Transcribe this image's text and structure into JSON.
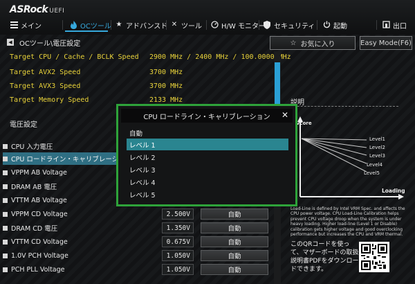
{
  "brand": {
    "name": "ASRock",
    "suffix": "UEFI"
  },
  "nav": [
    {
      "id": "main",
      "label": "メイン",
      "icon": "list-icon"
    },
    {
      "id": "oc",
      "label": "OCツール",
      "icon": "flame-icon",
      "active": true
    },
    {
      "id": "advanced",
      "label": "アドバンスド",
      "icon": "star-icon"
    },
    {
      "id": "tool",
      "label": "ツール",
      "icon": "wrench-icon"
    },
    {
      "id": "hw",
      "label": "H/W モニター",
      "icon": "monitor-icon"
    },
    {
      "id": "security",
      "label": "セキュリティ",
      "icon": "shield-icon"
    },
    {
      "id": "boot",
      "label": "起動",
      "icon": "power-icon"
    },
    {
      "id": "exit",
      "label": "出口",
      "icon": "exit-icon"
    }
  ],
  "breadcrumb": "OCツール\\電圧設定",
  "buttons": {
    "favorite": "お気に入り",
    "easy_mode": "Easy Mode(F6)"
  },
  "info_rows": [
    {
      "label": "Target CPU / Cache / BCLK Speed",
      "value": "2900 MHz / 2400 MHz / 100.0000 MHz"
    },
    {
      "label": "Target AVX2 Speed",
      "value": "3700 MHz"
    },
    {
      "label": "Target AVX3 Speed",
      "value": "3700 MHz"
    },
    {
      "label": "Target Memory Speed",
      "value": "2133 MHz"
    }
  ],
  "section_title": "電圧設定",
  "settings": [
    {
      "label": "CPU 入力電圧",
      "value": "",
      "mode": ""
    },
    {
      "label": "CPU ロードライン・キャリブレーション",
      "value": "",
      "mode": "",
      "selected": true
    },
    {
      "label": "VPPM AB  Voltage",
      "value": "",
      "mode": ""
    },
    {
      "label": "DRAM AB 電圧",
      "value": "",
      "mode": ""
    },
    {
      "label": "VTTM AB  Voltage",
      "value": "",
      "mode": ""
    },
    {
      "label": "VPPM CD  Voltage",
      "value": "2.500V",
      "mode": "自動"
    },
    {
      "label": "DRAM CD 電圧",
      "value": "1.350V",
      "mode": "自動"
    },
    {
      "label": "VTTM CD  Voltage",
      "value": "0.675V",
      "mode": "自動"
    },
    {
      "label": "1.0V PCH Voltage",
      "value": "1.050V",
      "mode": "自動"
    },
    {
      "label": "PCH PLL  Voltage",
      "value": "1.050V",
      "mode": "自動"
    }
  ],
  "description": {
    "title": "説明",
    "graph": {
      "y_label": "Vcore",
      "x_label": "Loading",
      "levels": [
        "Level1",
        "Level2",
        "Level3",
        "Level4",
        "Level5"
      ]
    },
    "text": "Load-Line is defined by Intel VRM Spec. and affects the CPU power voltage. CPU Load-Line Calibration helps prevent CPU voltage droop when the system is under heavy loading. Higher load-line (Level 1 or Disable) calibration gets higher voltage and good overclocking performance but increases the CPU and VRM thermal.",
    "qr_text": "このQRコードを使って、マザーボードの取扱説明書PDFをダウンロードできます。"
  },
  "modal": {
    "title": "CPU ロードライン・キャリブレーション",
    "options": [
      "自動",
      "レベル 1",
      "レベル 2",
      "レベル 3",
      "レベル 4",
      "レベル 5"
    ],
    "selected_index": 1
  },
  "colors": {
    "accent": "#36a8dc",
    "modal_border": "#2ea33a",
    "selected_row": "#2f6f83",
    "option_highlight": "#2a8590",
    "info_text": "#e8d23a"
  }
}
